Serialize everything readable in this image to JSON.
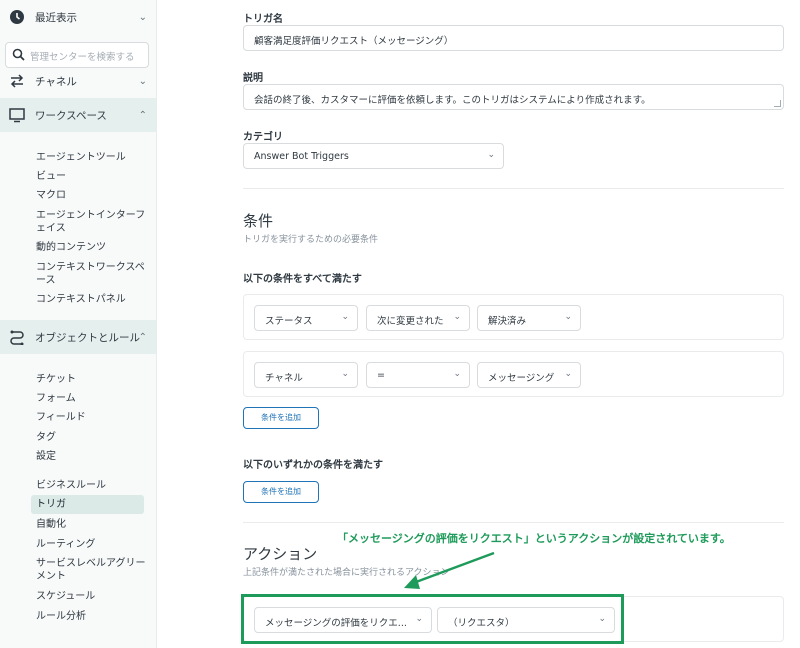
{
  "sidebar": {
    "recent": {
      "label": "最近表示"
    },
    "search": {
      "placeholder": "管理センターを検索する"
    },
    "channels": {
      "label": "チャネル"
    },
    "workspace": {
      "label": "ワークスペース",
      "items": [
        "エージェントツール",
        "ビュー",
        "マクロ",
        "エージェントインターフェイス",
        "動的コンテンツ",
        "コンテキストワークスペース",
        "コンテキストパネル"
      ]
    },
    "objects": {
      "label": "オブジェクトとルール",
      "items": [
        "チケット",
        "フォーム",
        "フィールド",
        "タグ",
        "設定"
      ],
      "business_rules_label": "ビジネスルール",
      "rules": [
        "トリガ",
        "自動化",
        "ルーティング",
        "サービスレベルアグリーメント",
        "スケジュール",
        "ルール分析"
      ]
    }
  },
  "form": {
    "name_label": "トリガ名",
    "name_value": "顧客満足度評価リクエスト（メッセージング）",
    "desc_label": "説明",
    "desc_value": "会話の終了後、カスタマーに評価を依頼します。このトリガはシステムにより作成されます。",
    "category_label": "カテゴリ",
    "category_value": "Answer Bot Triggers"
  },
  "conditions": {
    "title": "条件",
    "subtitle": "トリガを実行するための必要条件",
    "all_label": "以下の条件をすべて満たす",
    "rows": [
      {
        "field": "ステータス",
        "operator": "次に変更された",
        "value": "解決済み"
      },
      {
        "field": "チャネル",
        "operator": "=",
        "value": "メッセージング"
      }
    ],
    "add_button": "条件を追加",
    "any_label": "以下のいずれかの条件を満たす",
    "add_button_any": "条件を追加"
  },
  "actions": {
    "title": "アクション",
    "subtitle": "上記条件が満たされた場合に実行されるアクション",
    "action_value": "メッセージングの評価をリクエ...",
    "target_value": "（リクエスタ）"
  },
  "annotation": {
    "text": "「メッセージングの評価をリクエスト」というアクションが設定されています。",
    "color": "#1e9b5a"
  }
}
